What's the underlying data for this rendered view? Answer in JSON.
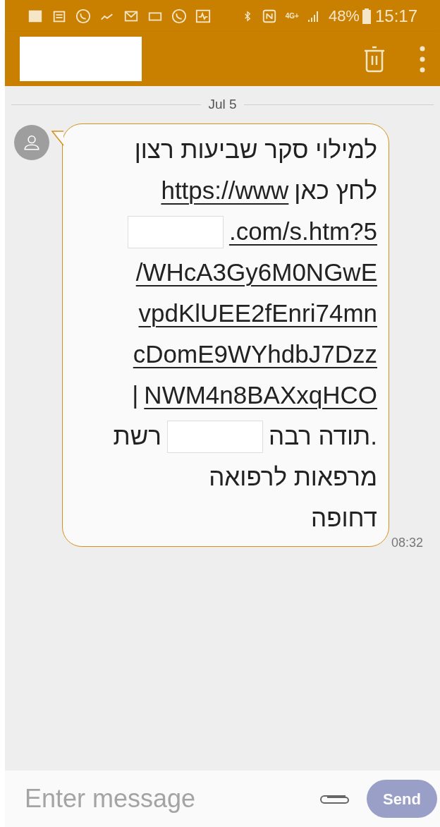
{
  "status_bar": {
    "network": "4G+",
    "battery": "48%",
    "time": "15:17"
  },
  "date_separator": "Jul 5",
  "message": {
    "lines": [
      [
        {
          "kind": "text",
          "text": "למילוי סקר שביעות רצון"
        }
      ],
      [
        {
          "kind": "text",
          "text": "לחץ כאן"
        },
        {
          "kind": "link",
          "text": "https://www"
        }
      ],
      [
        {
          "kind": "link",
          "text": ".com/s.htm?5"
        },
        {
          "kind": "redacted"
        }
      ],
      [
        {
          "kind": "link",
          "text": "/WHcA3Gy6M0NGwE"
        }
      ],
      [
        {
          "kind": "link",
          "text": "vpdKlUEE2fEnri74mn"
        }
      ],
      [
        {
          "kind": "link",
          "text": "cDomE9WYhdbJ7Dzz"
        }
      ],
      [
        {
          "kind": "link",
          "text": "NWM4n8BAXxqHCO"
        },
        {
          "kind": "text",
          "text": "|"
        }
      ],
      [
        {
          "kind": "text",
          "text": ".תודה רבה"
        },
        {
          "kind": "redacted"
        },
        {
          "kind": "text",
          "text": "רשת"
        }
      ],
      [
        {
          "kind": "text",
          "text": "מרפאות לרפואה"
        }
      ],
      [
        {
          "kind": "text",
          "text": "דחופה"
        }
      ]
    ],
    "time": "08:32"
  },
  "composer": {
    "placeholder": "Enter message",
    "send": "Send"
  }
}
